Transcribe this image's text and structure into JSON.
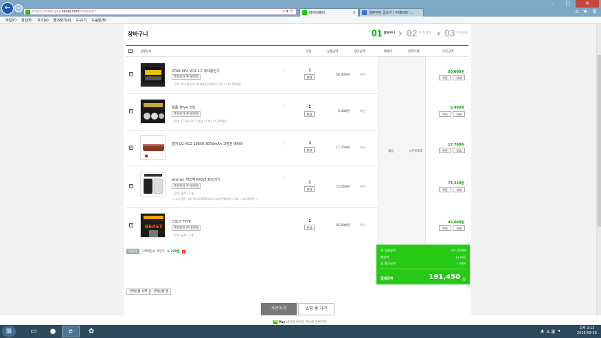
{
  "browser": {
    "url_plain": "https://order.pay.",
    "url_bold": "naver.com",
    "url_rest": "/mall/cart",
    "tabs": [
      {
        "label": "네이버페이"
      },
      {
        "label": "일촌단번 글쓰기 | 아메이프 -..."
      }
    ],
    "menu": [
      "파일(F)",
      "편집(E)",
      "보기(V)",
      "즐겨찾기(A)",
      "도구(T)",
      "도움말(H)"
    ]
  },
  "page": {
    "title": "장바구니",
    "steps": [
      {
        "num": "01",
        "label": "장바구니",
        "active": true
      },
      {
        "num": "02",
        "label": "주문/결제",
        "active": false
      },
      {
        "num": "03",
        "label": "주문완료",
        "active": false
      }
    ],
    "columns": {
      "product": "상품정보",
      "qty": "수량",
      "price": "상품금액",
      "discount": "할인금액",
      "shipping": "배송비",
      "ship_method": "판매자명",
      "order_amount": "주문금액"
    },
    "items": [
      {
        "name": "XTAR VP4 VC4 4구 휴대충전기",
        "option_btn": "주문조건 추가/변경",
        "option": "- 선택: VC4충전기+파워충전어댑터 / 1개 (+15,000원)",
        "qty": "1",
        "qty_btn": "변경",
        "price": "50,000원",
        "discount": "0원",
        "order_price": "50,000",
        "unit": "원",
        "order_btn": "주문",
        "del_btn": "삭제"
      },
      {
        "name": "정품 TFV4 코일",
        "option_btn": "주문조건 추가/변경",
        "option": "- 선택: TF-S6 coil 0.4옴 / 1개 (+5,399원)",
        "qty": "1",
        "qty_btn": "변경",
        "price": "5,400원",
        "discount": "0원",
        "order_price": "5,400",
        "unit": "원",
        "order_btn": "주문",
        "del_btn": "삭제"
      },
      {
        "name": "엘지 LG HG2 18650 3000mAh 고방전 배터리",
        "option_btn": "",
        "option": "",
        "qty": "3",
        "qty_btn": "변경",
        "price": "17,700원",
        "discount": "0원",
        "order_price": "17,700",
        "unit": "원",
        "order_btn": "주문",
        "del_btn": "삭제"
      },
      {
        "name": "wismec 위즈맥 RX2/3 모드기기",
        "option_btn": "주문조건 추가/변경",
        "option": "- 선택: 블랙 / 1개",
        "option2": "↳ 추가상품 : LG HG2(3000mAh)고방전배터리 / 1개 (+6,390원)  ✕",
        "qty": "1",
        "qty_btn": "변경",
        "price": "73,350원",
        "discount": "0원",
        "order_price": "73,350",
        "unit": "원",
        "order_btn": "주문",
        "del_btn": "삭제"
      },
      {
        "name": "스모크 TFV8",
        "option_btn": "주문조건 추가/변경",
        "option": "- 선택: 블랙 / 1개",
        "qty": "1",
        "qty_btn": "변경",
        "price": "45,000원",
        "discount": "0원",
        "order_price": "45,000",
        "unit": "원",
        "order_btn": "주문",
        "del_btn": "삭제"
      }
    ],
    "shipping_fee": "묶음",
    "seller": "시가유토리",
    "points_tag": "적립예정",
    "points_label": "구매확정시 포인트",
    "points_value": "1,729",
    "points_unit": "원",
    "summary": {
      "product_total_label": "총 상품금액",
      "product_total": "191,450원",
      "shipping_label": "배송비",
      "shipping": "(+)0원",
      "discount_label": "총 할인금액",
      "discount": "(-)0원",
      "final_label": "결제금액",
      "final": "191,450",
      "final_unit": "원"
    },
    "delete_selected": "선택상품 삭제",
    "select_all": "선택상품 찜",
    "order_button": "주문하기",
    "shop_button": "쇼핑 홈 가기",
    "npay_text": "Pay",
    "npay_desc": "네이버 아이디 하나로 간편구매"
  },
  "taskbar": {
    "time": "오후 2:12",
    "date": "2016-09-26",
    "ime": "A 漢"
  }
}
